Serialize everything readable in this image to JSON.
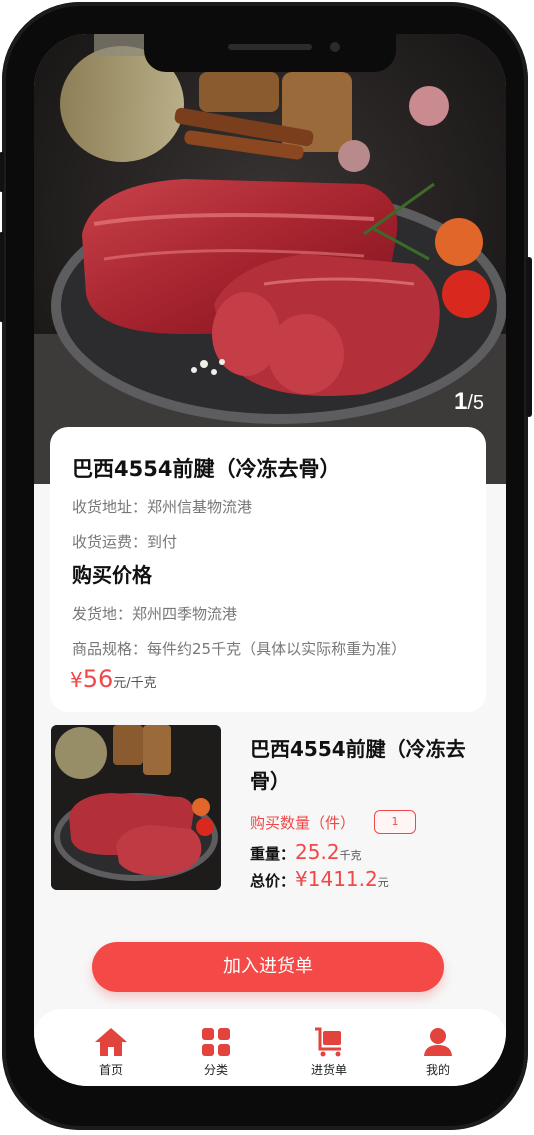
{
  "hero": {
    "pager_current": "1",
    "pager_total": "/5"
  },
  "product": {
    "title": "巴西4554前腱（冷冻去骨）",
    "address_label": "收货地址：",
    "address_value": "郑州信基物流港",
    "shipping_label": "收货运费：",
    "shipping_value": "到付",
    "section_title": "购买价格",
    "origin_label": "发货地：",
    "origin_value": "郑州四季物流港",
    "spec_label": "商品规格：",
    "spec_value": "每件约25千克（具体以实际称重为准）",
    "price_symbol": "¥",
    "price_value": "56",
    "price_unit": "元/千克"
  },
  "cart_item": {
    "name": "巴西4554前腱（冷冻去骨）",
    "qty_label": "购买数量（件）",
    "qty_value": "1",
    "weight_label": "重量：",
    "weight_value": "25.2",
    "weight_unit": "千克",
    "total_label": "总价：",
    "total_value": "¥1411.2",
    "total_unit": "元"
  },
  "add_button": "加入进货单",
  "tabs": [
    {
      "label": "首页",
      "icon": "home-icon"
    },
    {
      "label": "分类",
      "icon": "category-icon"
    },
    {
      "label": "进货单",
      "icon": "cart-icon"
    },
    {
      "label": "我的",
      "icon": "user-icon"
    }
  ],
  "colors": {
    "accent": "#f04848",
    "button": "#f44a47"
  }
}
